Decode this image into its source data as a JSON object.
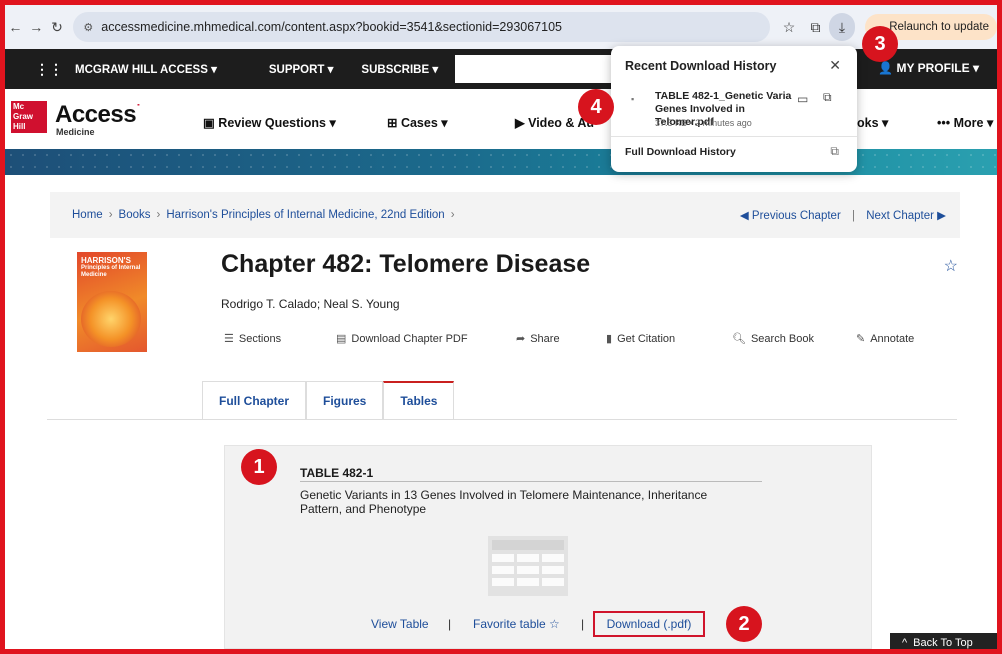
{
  "browser": {
    "url": "accessmedicine.mhmedical.com/content.aspx?bookid=3541&sectionid=293067105",
    "relaunch_label": "Relaunch to update"
  },
  "site_top": {
    "brand": "MCGRAW HILL ACCESS",
    "support": "SUPPORT",
    "subscribe": "SUBSCRIBE",
    "profile": "MY PROFILE"
  },
  "site_header": {
    "logo_mh": "Mc Graw Hill",
    "logo_access": "Access",
    "logo_sub": "Medicine",
    "nav": [
      "Review Questions",
      "Cases",
      "Video & Au",
      "oks",
      "More"
    ]
  },
  "breadcrumb": {
    "items": [
      "Home",
      "Books",
      "Harrison's Principles of Internal Medicine, 22nd Edition"
    ],
    "previous": "Previous Chapter",
    "next": "Next Chapter"
  },
  "book": {
    "cover_title": "HARRISON'S",
    "cover_sub": "Principles of Internal Medicine"
  },
  "chapter": {
    "title": "Chapter 482: Telomere Disease",
    "authors": "Rodrigo T. Calado; Neal S. Young"
  },
  "toolbar": {
    "sections": "Sections",
    "download_pdf": "Download Chapter PDF",
    "share": "Share",
    "citation": "Get Citation",
    "search": "Search Book",
    "annotate": "Annotate"
  },
  "tabs": [
    "Full Chapter",
    "Figures",
    "Tables"
  ],
  "table_card": {
    "label": "TABLE 482-1",
    "caption": "Genetic Variants in 13 Genes Involved in Telomere Maintenance, Inheritance Pattern, and Phenotype",
    "view": "View Table",
    "favorite": "Favorite table",
    "download": "Download (.pdf)",
    "separator": "|"
  },
  "back_to_top": "Back To Top",
  "download_popup": {
    "header": "Recent Download History",
    "file_name": "TABLE 482-1_Genetic Varia Genes Involved in Telomer.pdf",
    "file_meta": "37.5 KB • 2 minutes ago",
    "full_history": "Full Download History"
  },
  "callouts": [
    "1",
    "2",
    "3",
    "4"
  ],
  "colors": {
    "annotation_red": "#d7141e",
    "link_blue": "#1e4e9a",
    "brand_red": "#d0102f"
  }
}
